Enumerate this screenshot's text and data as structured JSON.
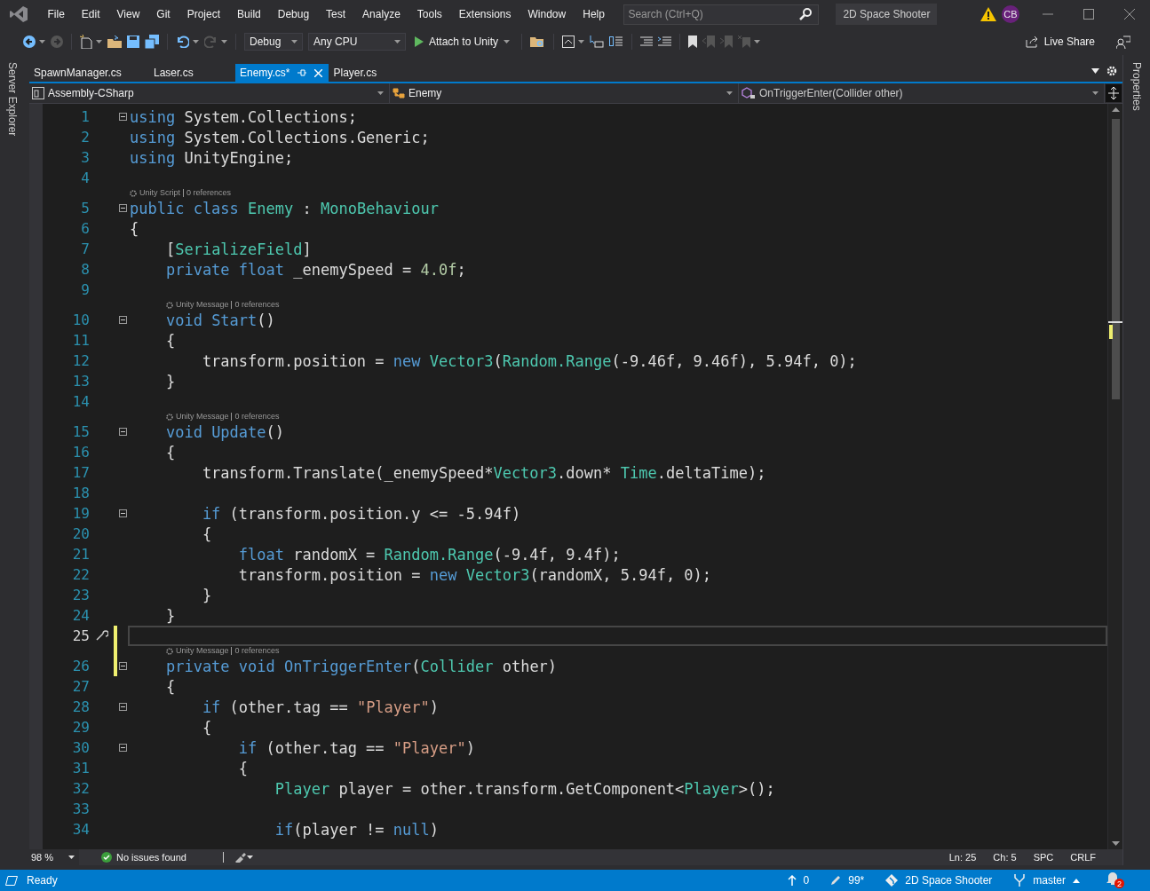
{
  "menu": [
    "File",
    "Edit",
    "View",
    "Git",
    "Project",
    "Build",
    "Debug",
    "Test",
    "Analyze",
    "Tools",
    "Extensions",
    "Window",
    "Help"
  ],
  "search": {
    "placeholder": "Search (Ctrl+Q)"
  },
  "solution_name": "2D Space Shooter",
  "user_initials": "CB",
  "toolbar": {
    "configuration": "Debug",
    "platform": "Any CPU",
    "run_button": "Attach to Unity",
    "live_share": "Live Share"
  },
  "left_panel": "Server Explorer",
  "right_panel": "Properties",
  "tabs": [
    {
      "label": "SpawnManager.cs",
      "selected": false
    },
    {
      "label": "Laser.cs",
      "selected": false
    },
    {
      "label": "Enemy.cs*",
      "selected": true
    },
    {
      "label": "Player.cs",
      "selected": false
    }
  ],
  "nav": {
    "project": "Assembly-CSharp",
    "class": "Enemy",
    "member": "OnTriggerEnter(Collider other)"
  },
  "code_lines": [
    {
      "n": "1",
      "fold": true,
      "changed": false,
      "current": false,
      "t": [
        {
          "kind": "keyword",
          "text": "using"
        },
        {
          "kind": "plain",
          "text": " System.Collections;"
        }
      ]
    },
    {
      "n": "2",
      "fold": false,
      "changed": false,
      "current": false,
      "t": [
        {
          "kind": "keyword",
          "text": "using"
        },
        {
          "kind": "plain",
          "text": " System.Collections.Generic;"
        }
      ]
    },
    {
      "n": "3",
      "fold": false,
      "changed": false,
      "current": false,
      "t": [
        {
          "kind": "keyword",
          "text": "using"
        },
        {
          "kind": "plain",
          "text": " UnityEngine;"
        }
      ]
    },
    {
      "n": "4",
      "fold": false,
      "changed": false,
      "current": false
    },
    {
      "n": "5",
      "fold": true,
      "changed": false,
      "current": false,
      "lens": [
        "Unity Script",
        "0 references"
      ],
      "t": [
        {
          "kind": "keyword",
          "text": "public class"
        },
        {
          "kind": "type",
          "text": " Enemy"
        },
        {
          "kind": "plain",
          "text": " : "
        },
        {
          "kind": "type",
          "text": "MonoBehaviour"
        }
      ]
    },
    {
      "n": "6",
      "fold": false,
      "changed": false,
      "current": false,
      "t": [
        {
          "kind": "plain",
          "text": "{"
        }
      ]
    },
    {
      "n": "7",
      "fold": false,
      "changed": false,
      "current": false,
      "t": [
        {
          "kind": "plain",
          "text": "    ["
        },
        {
          "kind": "type",
          "text": "SerializeField"
        },
        {
          "kind": "plain",
          "text": "]"
        }
      ]
    },
    {
      "n": "8",
      "fold": false,
      "changed": false,
      "current": false,
      "t": [
        {
          "kind": "keyword",
          "text": "    private float"
        },
        {
          "kind": "plain",
          "text": " _enemySpeed = "
        },
        {
          "kind": "number",
          "text": "4.0f"
        },
        {
          "kind": "plain",
          "text": ";"
        }
      ]
    },
    {
      "n": "9",
      "fold": false,
      "changed": false,
      "current": false
    },
    {
      "n": "10",
      "fold": true,
      "changed": false,
      "current": false,
      "lens": [
        "Unity Message",
        "0 references"
      ],
      "t": [
        {
          "kind": "keyword",
          "text": "    void"
        },
        {
          "kind": "keyword",
          "text": " Start"
        },
        {
          "kind": "plain",
          "text": "()"
        }
      ]
    },
    {
      "n": "11",
      "fold": false,
      "changed": false,
      "current": false,
      "t": [
        {
          "kind": "plain",
          "text": "    {"
        }
      ]
    },
    {
      "n": "12",
      "fold": false,
      "changed": false,
      "current": false,
      "t": [
        {
          "kind": "plain",
          "text": "        transform.position = "
        },
        {
          "kind": "keyword",
          "text": "new"
        },
        {
          "kind": "type",
          "text": " Vector3"
        },
        {
          "kind": "plain",
          "text": "("
        },
        {
          "kind": "type",
          "text": "Random.Range"
        },
        {
          "kind": "plain",
          "text": "(-9.46f, 9.46f), 5.94f, 0);"
        }
      ]
    },
    {
      "n": "13",
      "fold": false,
      "changed": false,
      "current": false,
      "t": [
        {
          "kind": "plain",
          "text": "    }"
        }
      ]
    },
    {
      "n": "14",
      "fold": false,
      "changed": false,
      "current": false
    },
    {
      "n": "15",
      "fold": true,
      "changed": false,
      "current": false,
      "lens": [
        "Unity Message",
        "0 references"
      ],
      "t": [
        {
          "kind": "keyword",
          "text": "    void"
        },
        {
          "kind": "keyword",
          "text": " Update"
        },
        {
          "kind": "plain",
          "text": "()"
        }
      ]
    },
    {
      "n": "16",
      "fold": false,
      "changed": false,
      "current": false,
      "t": [
        {
          "kind": "plain",
          "text": "    {"
        }
      ]
    },
    {
      "n": "17",
      "fold": false,
      "changed": false,
      "current": false,
      "t": [
        {
          "kind": "plain",
          "text": "        transform.Translate(_enemySpeed*"
        },
        {
          "kind": "type",
          "text": "Vector3"
        },
        {
          "kind": "plain",
          "text": ".down* "
        },
        {
          "kind": "type",
          "text": "Time"
        },
        {
          "kind": "plain",
          "text": ".deltaTime);"
        }
      ]
    },
    {
      "n": "18",
      "fold": false,
      "changed": false,
      "current": false
    },
    {
      "n": "19",
      "fold": true,
      "changed": false,
      "current": false,
      "t": [
        {
          "kind": "keyword",
          "text": "        if"
        },
        {
          "kind": "plain",
          "text": " (transform.position.y <= -5.94f)"
        }
      ]
    },
    {
      "n": "20",
      "fold": false,
      "changed": false,
      "current": false,
      "t": [
        {
          "kind": "plain",
          "text": "        {"
        }
      ]
    },
    {
      "n": "21",
      "fold": false,
      "changed": false,
      "current": false,
      "t": [
        {
          "kind": "keyword",
          "text": "            float"
        },
        {
          "kind": "plain",
          "text": " randomX = "
        },
        {
          "kind": "type",
          "text": "Random.Range"
        },
        {
          "kind": "plain",
          "text": "(-9.4f, 9.4f);"
        }
      ]
    },
    {
      "n": "22",
      "fold": false,
      "changed": false,
      "current": false,
      "t": [
        {
          "kind": "plain",
          "text": "            transform.position = "
        },
        {
          "kind": "keyword",
          "text": "new"
        },
        {
          "kind": "type",
          "text": " Vector3"
        },
        {
          "kind": "plain",
          "text": "(randomX, 5.94f, 0);"
        }
      ]
    },
    {
      "n": "23",
      "fold": false,
      "changed": false,
      "current": false,
      "t": [
        {
          "kind": "plain",
          "text": "        }"
        }
      ]
    },
    {
      "n": "24",
      "fold": false,
      "changed": false,
      "current": false,
      "t": [
        {
          "kind": "plain",
          "text": "    }"
        }
      ]
    },
    {
      "n": "25",
      "fold": false,
      "changed": true,
      "current": true
    },
    {
      "n": "26",
      "fold": true,
      "changed": true,
      "current": false,
      "lens": [
        "Unity Message",
        "0 references"
      ],
      "t": [
        {
          "kind": "keyword",
          "text": "    private void"
        },
        {
          "kind": "keyword",
          "text": " OnTriggerEnter"
        },
        {
          "kind": "plain",
          "text": "("
        },
        {
          "kind": "type",
          "text": "Collider"
        },
        {
          "kind": "plain",
          "text": " other)"
        }
      ]
    },
    {
      "n": "27",
      "fold": false,
      "changed": false,
      "current": false,
      "t": [
        {
          "kind": "plain",
          "text": "    {"
        }
      ]
    },
    {
      "n": "28",
      "fold": true,
      "changed": false,
      "current": false,
      "t": [
        {
          "kind": "keyword",
          "text": "        if"
        },
        {
          "kind": "plain",
          "text": " (other.tag == "
        },
        {
          "kind": "string",
          "text": "\"Player\""
        },
        {
          "kind": "plain",
          "text": ")"
        }
      ]
    },
    {
      "n": "29",
      "fold": false,
      "changed": false,
      "current": false,
      "t": [
        {
          "kind": "plain",
          "text": "        {"
        }
      ]
    },
    {
      "n": "30",
      "fold": true,
      "changed": false,
      "current": false,
      "t": [
        {
          "kind": "keyword",
          "text": "            if"
        },
        {
          "kind": "plain",
          "text": " (other.tag == "
        },
        {
          "kind": "string",
          "text": "\"Player\""
        },
        {
          "kind": "plain",
          "text": ")"
        }
      ]
    },
    {
      "n": "31",
      "fold": false,
      "changed": false,
      "current": false,
      "t": [
        {
          "kind": "plain",
          "text": "            {"
        }
      ]
    },
    {
      "n": "32",
      "fold": false,
      "changed": false,
      "current": false,
      "t": [
        {
          "kind": "type",
          "text": "                Player"
        },
        {
          "kind": "plain",
          "text": " player = other.transform.GetComponent<"
        },
        {
          "kind": "type",
          "text": "Player"
        },
        {
          "kind": "plain",
          "text": ">();"
        }
      ]
    },
    {
      "n": "33",
      "fold": false,
      "changed": false,
      "current": false
    },
    {
      "n": "34",
      "fold": false,
      "changed": false,
      "current": false,
      "t": [
        {
          "kind": "keyword",
          "text": "                if"
        },
        {
          "kind": "plain",
          "text": "(player != "
        },
        {
          "kind": "keyword",
          "text": "null"
        },
        {
          "kind": "plain",
          "text": ")"
        }
      ]
    }
  ],
  "editor_status": {
    "zoom": "98 %",
    "issues": "No issues found",
    "line": "Ln: 25",
    "column": "Ch: 5",
    "whitespace": "SPC",
    "line_endings": "CRLF"
  },
  "status_bar": {
    "state": "Ready",
    "push": "0",
    "changes": "99*",
    "repository": "2D Space Shooter",
    "branch": "master",
    "notifications": "2"
  }
}
